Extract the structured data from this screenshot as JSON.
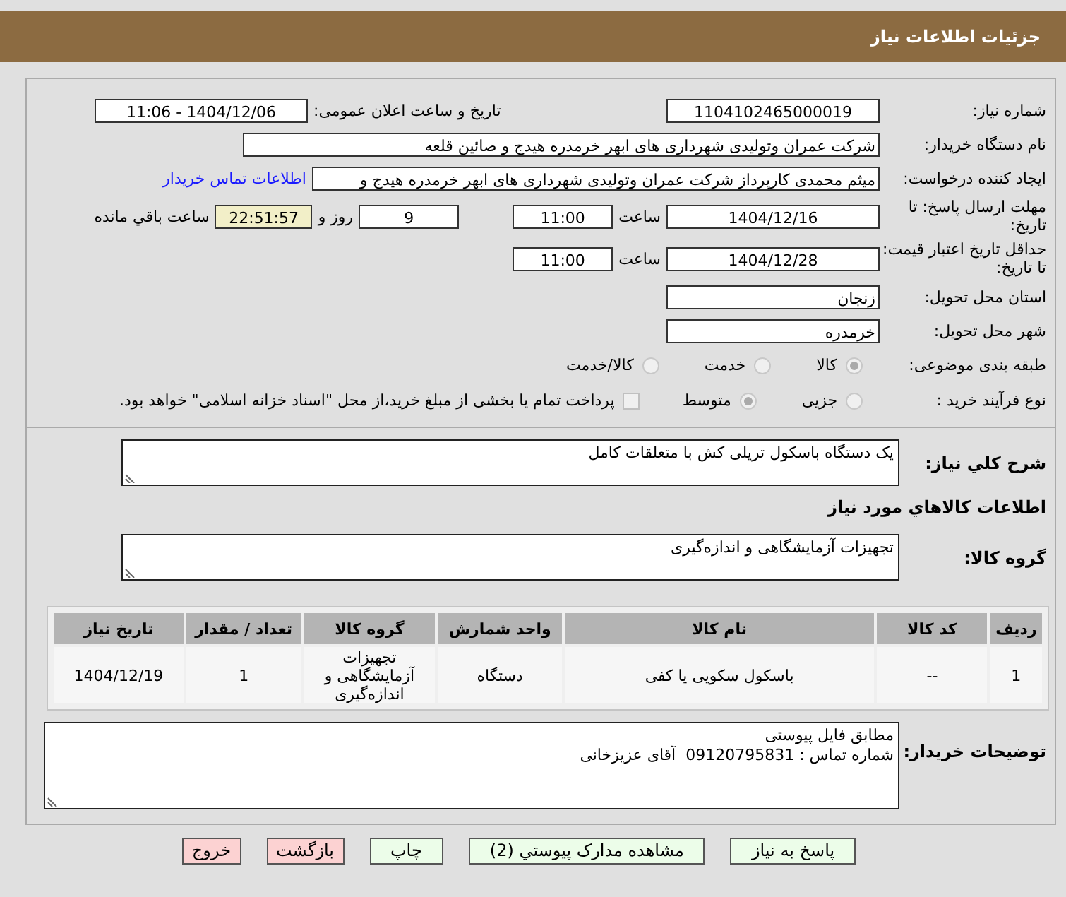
{
  "header": {
    "title": "جزئیات اطلاعات نیاز"
  },
  "need_number": {
    "label": "شماره نیاز:",
    "value": "1104102465000019"
  },
  "announce": {
    "label": "تاریخ و ساعت اعلان عمومی:",
    "value": "1404/12/06 - 11:06"
  },
  "buyer": {
    "label": "نام دستگاه خریدار:",
    "value": "شرکت عمران وتولیدی شهرداری های ابهر خرمدره هیدج و صائین قلعه"
  },
  "requester": {
    "label": "ایجاد کننده درخواست:",
    "value": "میثم محمدی کارپرداز شرکت عمران وتولیدی شهرداری های ابهر خرمدره هیدج و",
    "link": "اطلاعات تماس خریدار"
  },
  "deadline": {
    "label": "مهلت ارسال پاسخ: تا تاریخ:",
    "date": "1404/12/16",
    "time_label": "ساعت",
    "time": "11:00",
    "days": "9",
    "days_label": "روز و",
    "remaining": "22:51:57",
    "remaining_label": "ساعت باقي مانده"
  },
  "validity": {
    "label": "حداقل تاریخ اعتبار قیمت: تا تاریخ:",
    "date": "1404/12/28",
    "time_label": "ساعت",
    "time": "11:00"
  },
  "province": {
    "label": "استان محل تحویل:",
    "value": "زنجان"
  },
  "city": {
    "label": "شهر محل تحویل:",
    "value": "خرمدره"
  },
  "category": {
    "label": "طبقه بندی موضوعی:",
    "options": [
      {
        "label": "کالا",
        "selected": true
      },
      {
        "label": "خدمت",
        "selected": false
      },
      {
        "label": "کالا/خدمت",
        "selected": false
      }
    ]
  },
  "process": {
    "label": "نوع فرآیند خرید :",
    "options": [
      {
        "label": "جزیی",
        "selected": false
      },
      {
        "label": "متوسط",
        "selected": true
      }
    ],
    "treasury": {
      "checked": false,
      "text": "پرداخت تمام یا بخشی از مبلغ خرید،از محل \"اسناد خزانه اسلامی\" خواهد بود."
    }
  },
  "description": {
    "label": "شرح کلي نیاز:",
    "value": "یک دستگاه باسکول تریلی کش با متعلقات کامل"
  },
  "goods_title": "اطلاعات کالاهاي مورد نیاز",
  "goods_group": {
    "label": "گروه کالا:",
    "value": "تجهیزات آزمایشگاهی و اندازه‌گیری"
  },
  "table": {
    "columns": [
      "ردیف",
      "کد کالا",
      "نام کالا",
      "واحد شمارش",
      "گروه کالا",
      "تعداد / مقدار",
      "تاریخ نیاز"
    ],
    "rows": [
      [
        "1",
        "--",
        "باسکول سکویی یا کفی",
        "دستگاه",
        "تجهیزات آزمایشگاهی و اندازه‌گیری",
        "1",
        "1404/12/19"
      ]
    ]
  },
  "buyer_notes": {
    "label": "توضیحات خریدار:",
    "lines": [
      "مطابق فایل پیوستی",
      "شماره تماس : 09120795831  آقای عزیزخانی"
    ]
  },
  "buttons": [
    {
      "label": "پاسخ به نیاز",
      "kind": "green"
    },
    {
      "label": "مشاهده مدارک پیوستي (2)",
      "kind": "green"
    },
    {
      "label": "چاپ",
      "kind": "green"
    },
    {
      "label": "بازگشت",
      "kind": "red"
    },
    {
      "label": "خروج",
      "kind": "red"
    }
  ]
}
